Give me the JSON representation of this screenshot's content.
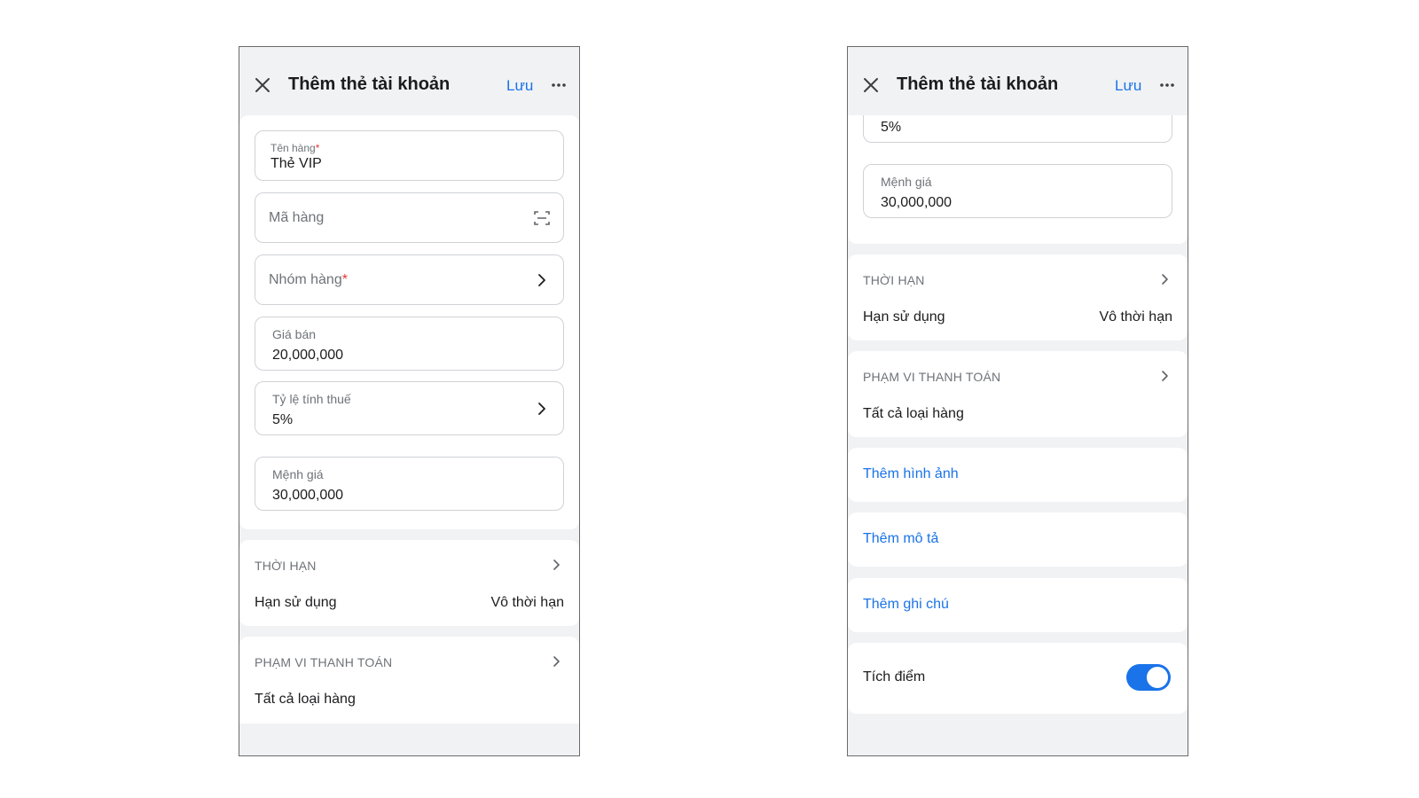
{
  "header": {
    "title": "Thêm thẻ tài khoản",
    "save_label": "Lưu"
  },
  "form": {
    "ten_hang": {
      "label": "Tên hàng",
      "required_mark": "*",
      "value": "Thẻ VIP"
    },
    "ma_hang": {
      "placeholder": "Mã hàng"
    },
    "nhom_hang": {
      "placeholder": "Nhóm hàng",
      "required_mark": "*"
    },
    "gia_ban": {
      "label": "Giá bán",
      "value": "20,000,000"
    },
    "ty_le_thue": {
      "label": "Tỷ lệ tính thuế",
      "value": "5%"
    },
    "menh_gia": {
      "label": "Mệnh giá",
      "value": "30,000,000"
    }
  },
  "thoi_han": {
    "heading": "THỜI HẠN",
    "row_label": "Hạn sử dụng",
    "row_value": "Vô thời hạn"
  },
  "pham_vi": {
    "heading": "PHẠM VI THANH TOÁN",
    "value": "Tất cả loại hàng"
  },
  "links": {
    "add_image": "Thêm hình ảnh",
    "add_description": "Thêm mô tả",
    "add_note": "Thêm ghi chú"
  },
  "tich_diem": {
    "label": "Tích điểm",
    "enabled": true
  },
  "colors": {
    "accent": "#1a73e8",
    "required": "#e53935",
    "background": "#f1f2f4"
  },
  "icons": {
    "close": "close-icon",
    "more": "more-horizontal-icon",
    "barcode": "barcode-scan-icon",
    "chevron": "chevron-right-icon"
  }
}
